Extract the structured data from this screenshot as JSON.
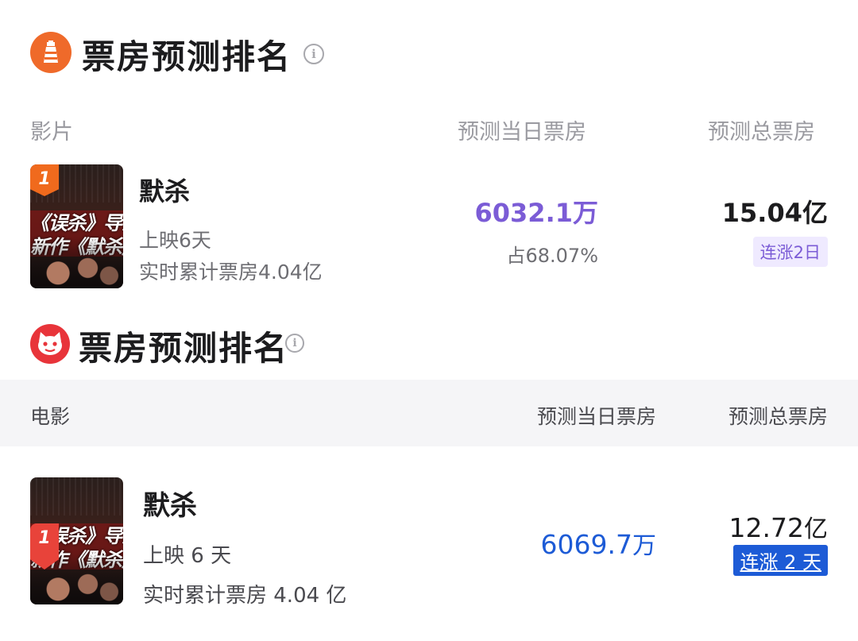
{
  "section1": {
    "title": "票房预测排名",
    "headers": {
      "film": "影片",
      "daily": "预测当日票房",
      "total": "预测总票房"
    },
    "movie": {
      "rank": "1",
      "name": "默杀",
      "days": "上映6天",
      "cumulative": "实时累计票房4.04亿",
      "daily": "6032.1万",
      "share": "占68.07%",
      "total": "15.04亿",
      "trend": "连涨2日",
      "poster_line1": "《误杀》导演",
      "poster_line2": "新作《默杀》"
    },
    "accent_color": "#ef6a2a",
    "value_color": "#7b5cd6"
  },
  "section2": {
    "title": "票房预测排名",
    "headers": {
      "film": "电影",
      "daily": "预测当日票房",
      "total": "预测总票房"
    },
    "movie": {
      "rank": "1",
      "name": "默杀",
      "days": "上映 6 天",
      "cumulative": "实时累计票房 4.04 亿",
      "daily_value": "6069.7",
      "daily_unit": "万",
      "total_value": "12.72",
      "total_unit": "亿",
      "trend": "连涨 2 天",
      "poster_line1": "《误杀》导演",
      "poster_line2": "新作《默杀》"
    },
    "accent_color": "#e8343a",
    "value_color": "#1d5bd6"
  },
  "icons": [
    "lighthouse-logo-icon",
    "cat-logo-icon",
    "info-icon"
  ]
}
